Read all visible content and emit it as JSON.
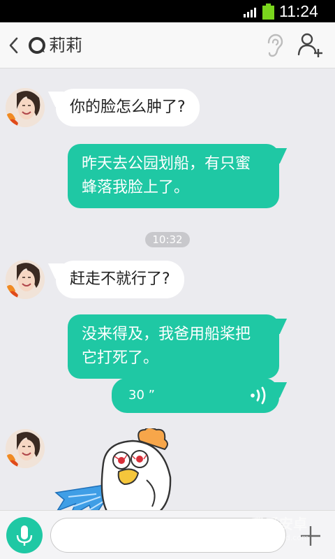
{
  "status_bar": {
    "time": "11:24",
    "signal_icon": "signal-icon",
    "battery_icon": "battery-icon",
    "battery_color": "#7ad61d"
  },
  "header": {
    "title": "莉莉",
    "back_icon": "back-icon",
    "contact_icon": "contact-icon",
    "ear_icon": "ear-icon",
    "add_icon": "add-user-icon"
  },
  "colors": {
    "accent": "#1fc8a4",
    "background": "#ebebef",
    "incoming_bubble": "#ffffff"
  },
  "messages": [
    {
      "side": "in",
      "text": "你的脸怎么肿了?"
    },
    {
      "side": "out",
      "text": "昨天去公园划船，有只蜜蜂落我脸上了。"
    },
    {
      "side": "in",
      "text": "赶走不就行了?"
    },
    {
      "side": "out",
      "text": "没来得及，我爸用船桨把它打死了。"
    },
    {
      "side": "out",
      "type": "voice",
      "duration": "30 ”"
    },
    {
      "side": "in",
      "type": "sticker",
      "sticker": "chicken-sticker"
    }
  ],
  "timestamp": "10:32",
  "input_bar": {
    "mic_icon": "mic-icon",
    "placeholder": "",
    "more_icon": "plus-icon"
  },
  "watermark": {
    "text": "我爱安卓",
    "sub": "52android.com"
  }
}
